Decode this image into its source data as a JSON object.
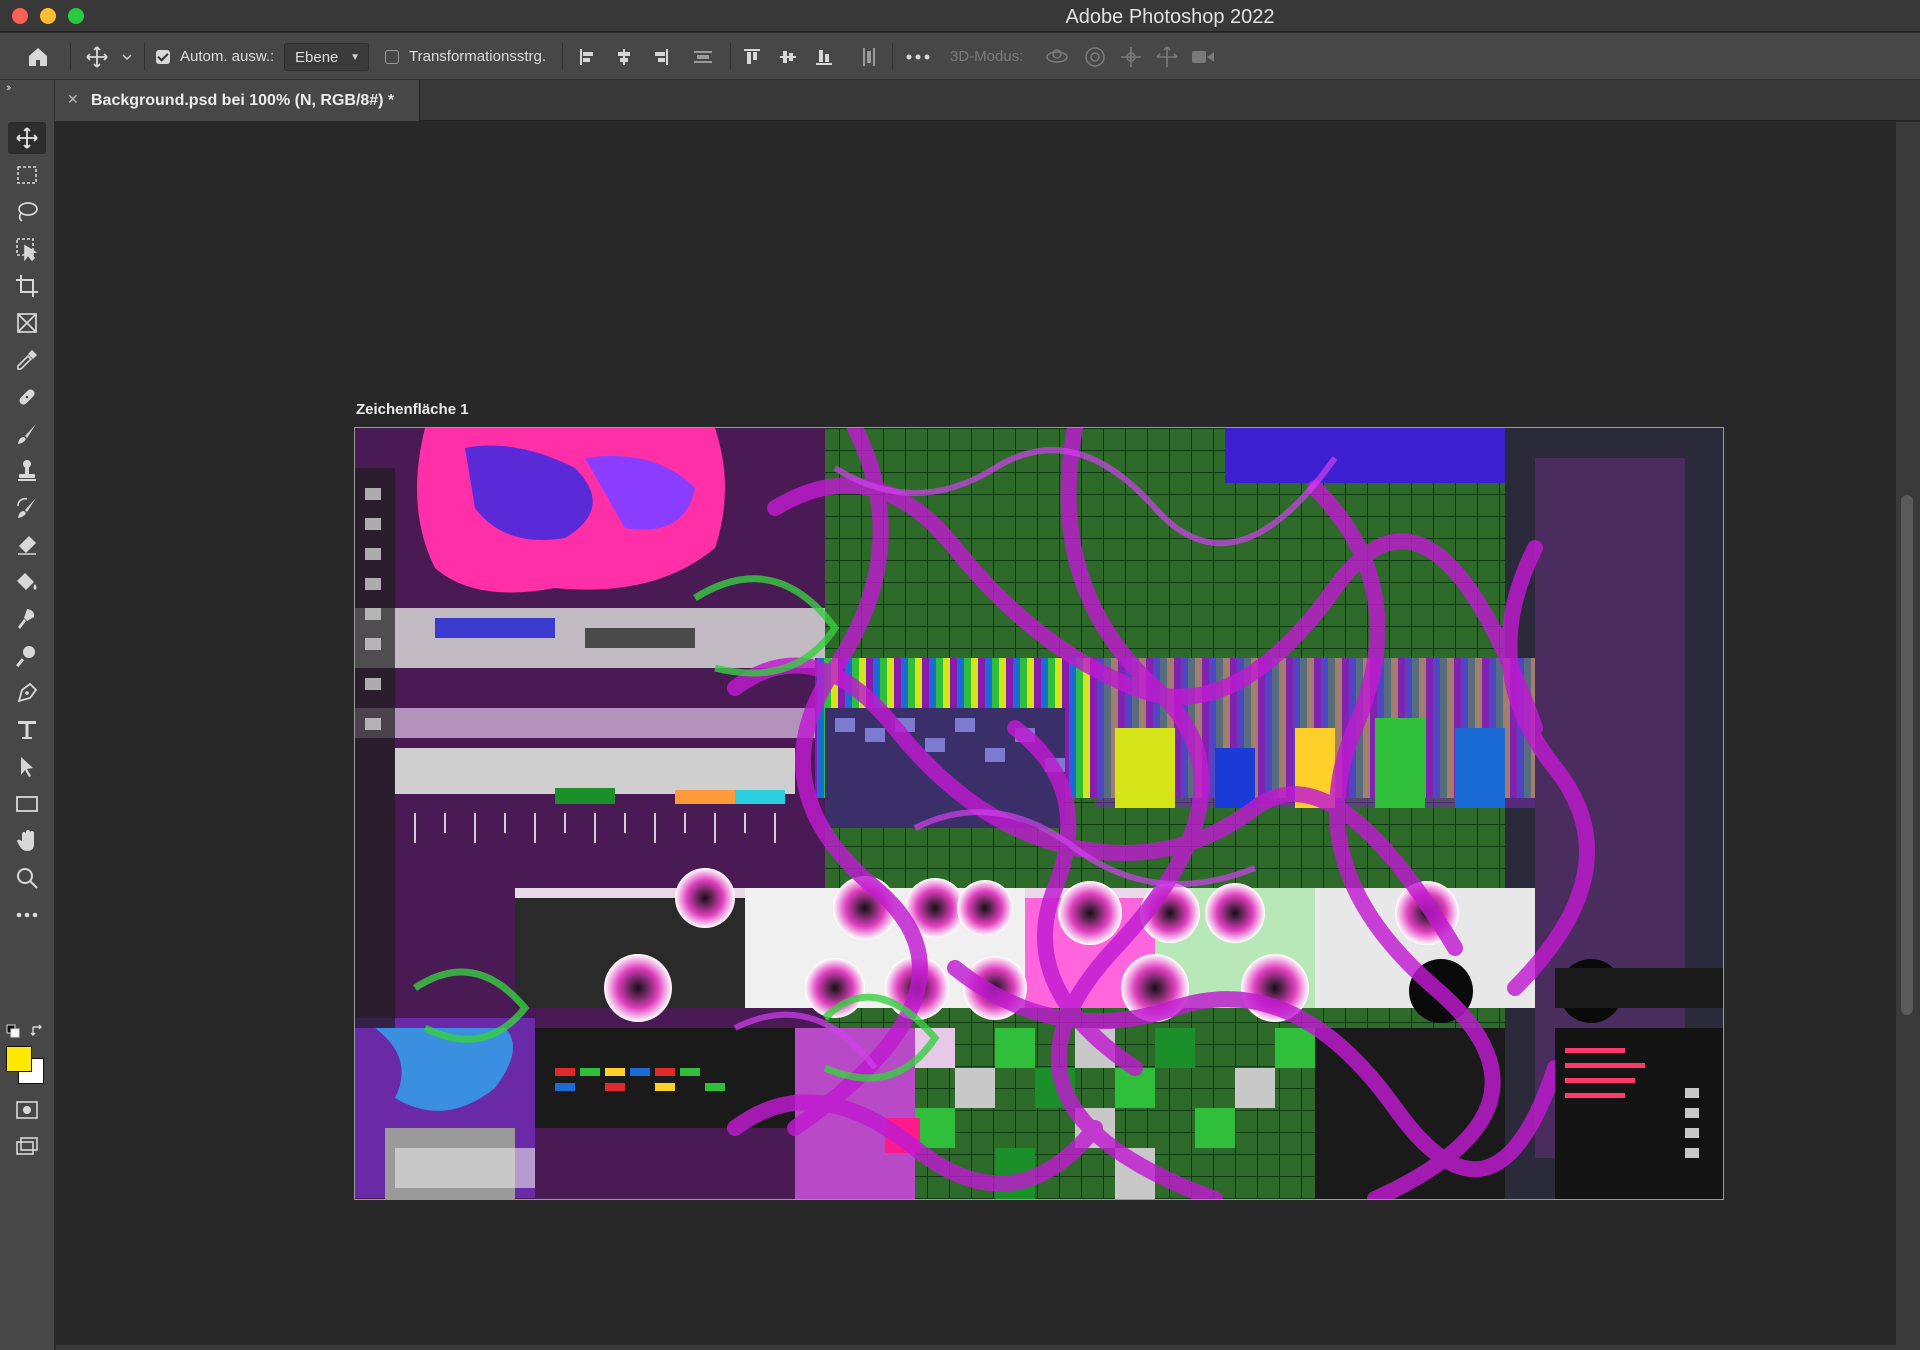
{
  "window": {
    "title": "Adobe Photoshop 2022"
  },
  "options_bar": {
    "auto_select_label": "Autom. ausw.:",
    "auto_select_checked": true,
    "auto_select_target": "Ebene",
    "transform_controls_label": "Transformationsstrg.",
    "transform_controls_checked": false,
    "mode_3d_label": "3D-Modus:"
  },
  "document_tab": {
    "label": "Background.psd bei 100% (N, RGB/8#) *"
  },
  "artboard": {
    "name": "Zeichenfläche 1"
  },
  "colors": {
    "foreground": "#ffe800",
    "background": "#ffffff",
    "ui_panel": "#474747",
    "ui_canvas": "#282828"
  },
  "tools": [
    "move-tool-icon",
    "marquee-tool-icon",
    "lasso-tool-icon",
    "object-select-tool-icon",
    "crop-tool-icon",
    "frame-tool-icon",
    "eyedropper-tool-icon",
    "healing-brush-tool-icon",
    "brush-tool-icon",
    "clone-stamp-tool-icon",
    "history-brush-tool-icon",
    "eraser-tool-icon",
    "paint-bucket-tool-icon",
    "smudge-tool-icon",
    "dodge-tool-icon",
    "pen-tool-icon",
    "type-tool-icon",
    "path-select-tool-icon",
    "rectangle-tool-icon",
    "hand-tool-icon",
    "zoom-tool-icon",
    "more-tools-icon"
  ]
}
